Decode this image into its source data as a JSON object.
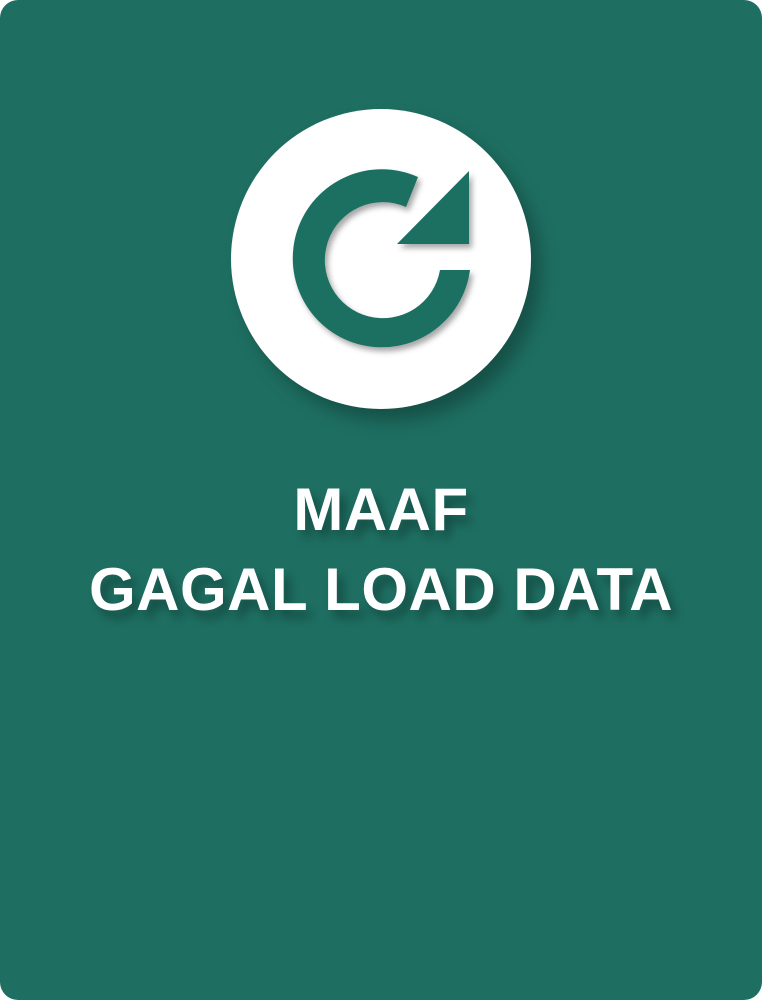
{
  "colors": {
    "card_background": "#1e6f62",
    "accent_white": "#ffffff"
  },
  "reload": {
    "icon": "refresh-icon"
  },
  "message": {
    "line1": "MAAF",
    "line2": "GAGAL LOAD DATA"
  }
}
